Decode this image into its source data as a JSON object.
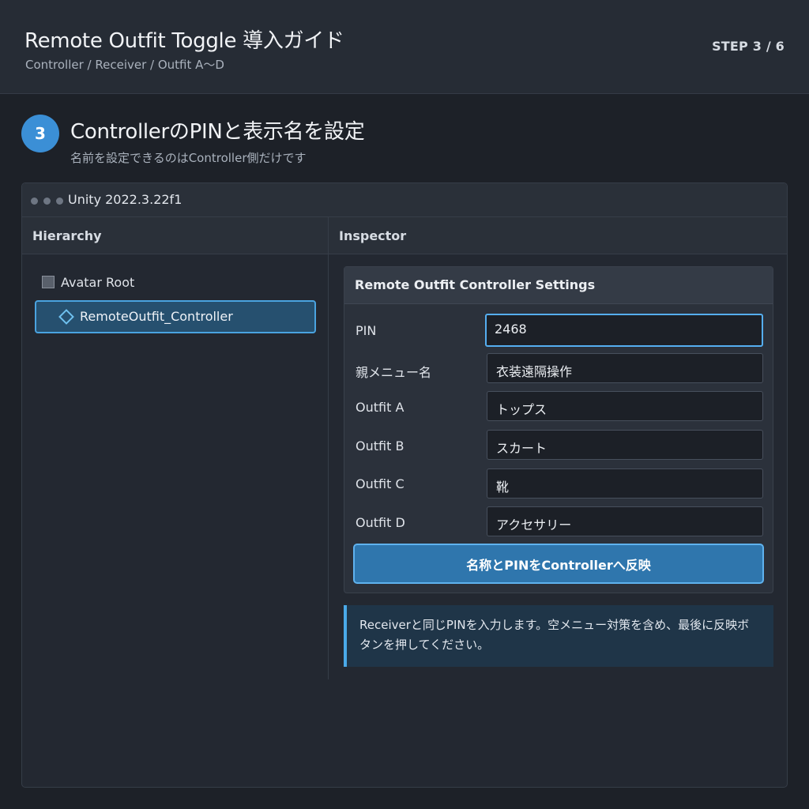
{
  "header": {
    "title": "Remote Outfit Toggle 導入ガイド",
    "subtitle": "Controller / Receiver / Outfit A〜D",
    "step": "STEP 3 / 6"
  },
  "step": {
    "number": "3",
    "title": "ControllerのPINと表示名を設定",
    "description": "名前を設定できるのはController側だけです"
  },
  "window": {
    "title": "Unity 2022.3.22f1"
  },
  "hierarchy": {
    "heading": "Hierarchy",
    "items": [
      {
        "label": "Avatar Root",
        "icon": "gameobject-icon"
      },
      {
        "label": "RemoteOutfit_Controller",
        "icon": "prefab-diamond-icon",
        "selected": true
      }
    ]
  },
  "inspector": {
    "heading": "Inspector",
    "component_title": "Remote Outfit Controller Settings",
    "fields": [
      {
        "label": "PIN",
        "value": "2468",
        "focused": true
      },
      {
        "label": "親メニュー名",
        "value": "衣装遠隔操作"
      },
      {
        "label": "Outfit A",
        "value": "トップス"
      },
      {
        "label": "Outfit B",
        "value": "スカート"
      },
      {
        "label": "Outfit C",
        "value": "靴"
      },
      {
        "label": "Outfit D",
        "value": "アクセサリー"
      }
    ],
    "apply_button": "名称とPINをControllerへ反映",
    "note": "Receiverと同じPINを入力します。空メニュー対策を含め、最後に反映ボタンを押してください。"
  },
  "colors": {
    "accent": "#3b8fd6",
    "selection": "#26506f",
    "button": "#2f76ad",
    "focus": "#55aef0"
  }
}
